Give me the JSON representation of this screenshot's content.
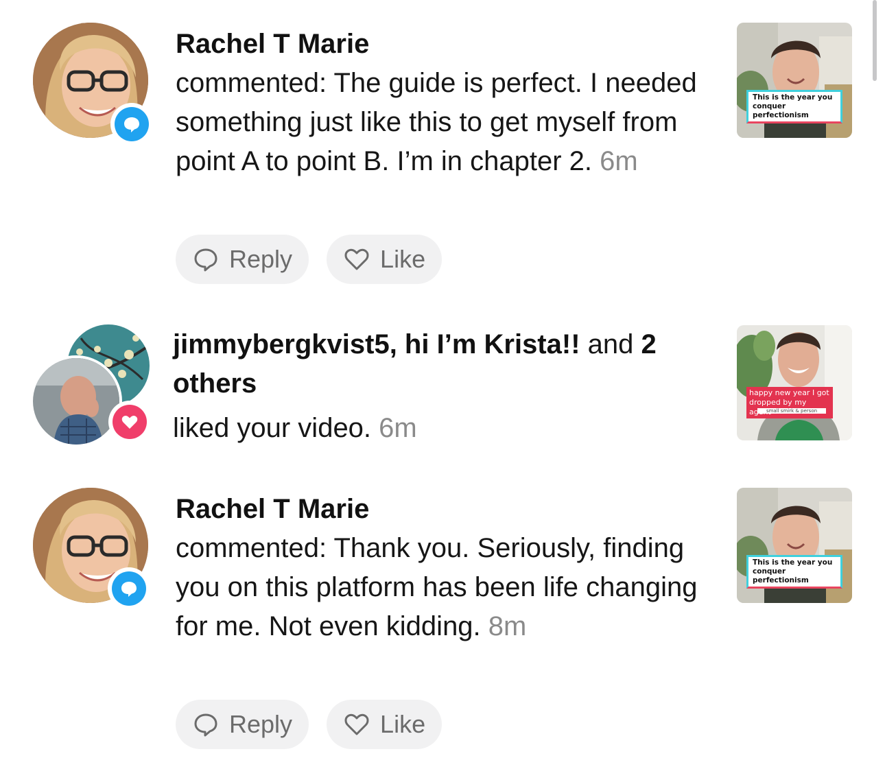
{
  "notifications": [
    {
      "name": "Rachel T Marie",
      "message": "commented: The guide is perfect. I needed something just like this to get myself from point A to point B. I’m in chapter 2.",
      "time": "6m",
      "badge_icon": "comment-bubble-icon",
      "badge_color": "#20a3f0",
      "reply_label": "Reply",
      "like_label": "Like",
      "thumbnail_caption": "This is the year you conquer perfectionism"
    },
    {
      "names": "jimmybergkvist5, hi I’m Krista!!",
      "connector": "and",
      "others": "2 others",
      "message": "liked your video.",
      "time": "6m",
      "badge_icon": "heart-icon",
      "badge_color": "#f03e6a",
      "thumbnail_caption": "happy new year I got dropped by my agent",
      "thumbnail_subcaption": "small smirk & person"
    },
    {
      "name": "Rachel T Marie",
      "message": "commented: Thank you. Seriously, finding you on this platform has been life changing for me. Not even kidding.",
      "time": "8m",
      "badge_icon": "comment-bubble-icon",
      "badge_color": "#20a3f0",
      "reply_label": "Reply",
      "like_label": "Like",
      "thumbnail_caption": "This is the year you conquer perfectionism"
    }
  ]
}
